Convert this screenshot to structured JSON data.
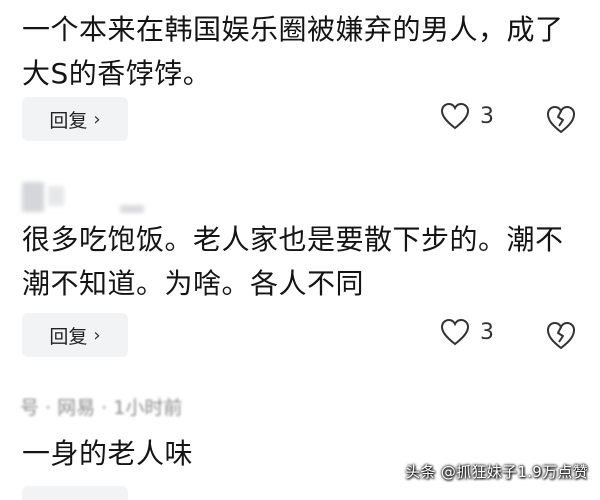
{
  "comments": [
    {
      "text": "一个本来在韩国娱乐圈被嫌弃的男人，成了大S的香饽饽。",
      "reply_label": "回复",
      "like_count": "3"
    },
    {
      "text": "很多吃饱饭。老人家也是要散下步的。潮不潮不知道。为啥。各人不同",
      "reply_label": "回复",
      "like_count": "3"
    },
    {
      "meta": "号 · 网易 · 1小时前",
      "text": "一身的老人味"
    }
  ],
  "icons": {
    "reply_chevron": "chevron-right-icon",
    "like": "heart-outline-icon",
    "dislike": "broken-heart-icon"
  },
  "watermark": "头条 @抓狂妹子1.9万点赞"
}
